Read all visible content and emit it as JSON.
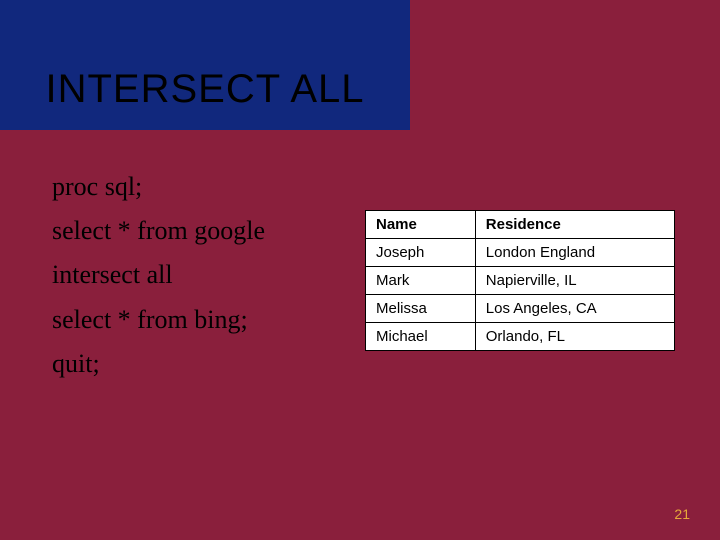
{
  "title": "INTERSECT ALL",
  "code": {
    "line1": "proc sql;",
    "line2": "select * from google",
    "line3": "intersect all",
    "line4": "select * from bing;",
    "line5": "quit;"
  },
  "table": {
    "headers": {
      "col1": "Name",
      "col2": "Residence"
    },
    "rows": [
      {
        "c1": "Joseph",
        "c2": "London England"
      },
      {
        "c1": "Mark",
        "c2": "Napierville, IL"
      },
      {
        "c1": "Melissa",
        "c2": "Los Angeles, CA"
      },
      {
        "c1": "Michael",
        "c2": "Orlando, FL"
      }
    ]
  },
  "pageNumber": "21"
}
